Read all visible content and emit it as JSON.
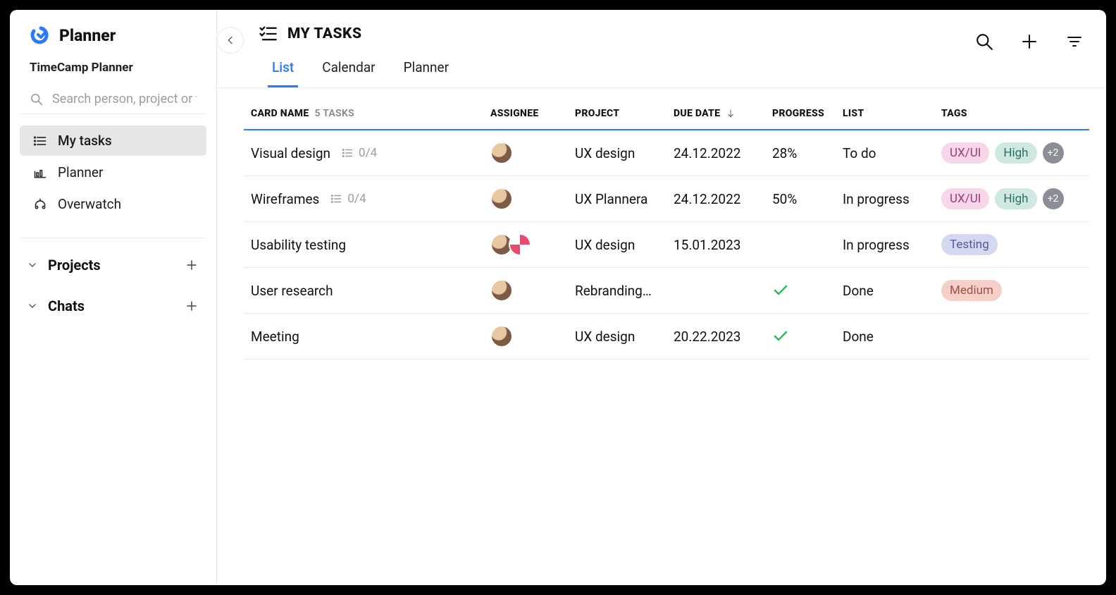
{
  "brand": {
    "app_name": "Planner",
    "org_name": "TimeCamp Planner"
  },
  "search": {
    "placeholder": "Search person, project or task"
  },
  "nav": {
    "items": [
      {
        "label": "My tasks",
        "icon": "tasks-icon",
        "active": true
      },
      {
        "label": "Planner",
        "icon": "planner-icon",
        "active": false
      },
      {
        "label": "Overwatch",
        "icon": "overwatch-icon",
        "active": false
      }
    ]
  },
  "sections": [
    {
      "title": "Projects"
    },
    {
      "title": "Chats"
    }
  ],
  "page": {
    "title": "MY TASKS",
    "tabs": [
      {
        "label": "List",
        "active": true
      },
      {
        "label": "Calendar",
        "active": false
      },
      {
        "label": "Planner",
        "active": false
      }
    ]
  },
  "table": {
    "headers": {
      "card_name": "CARD NAME",
      "task_count": "5 TASKS",
      "assignee": "ASSIGNEE",
      "project": "PROJECT",
      "due_date": "DUE DATE",
      "progress": "PROGRESS",
      "list": "LIST",
      "tags": "TAGS"
    },
    "rows": [
      {
        "name": "Visual design",
        "subtasks": "0/4",
        "assignees": 1,
        "project": "UX design",
        "due_date": "24.12.2022",
        "progress": "28%",
        "done": false,
        "list": "To do",
        "tags": [
          {
            "label": "UX/UI",
            "cls": "pink"
          },
          {
            "label": "High",
            "cls": "teal"
          }
        ],
        "tags_more": "+2"
      },
      {
        "name": "Wireframes",
        "subtasks": "0/4",
        "assignees": 1,
        "project": "UX Plannera",
        "due_date": "24.12.2022",
        "progress": "50%",
        "done": false,
        "list": "In progress",
        "tags": [
          {
            "label": "UX/UI",
            "cls": "pink"
          },
          {
            "label": "High",
            "cls": "teal"
          }
        ],
        "tags_more": "+2"
      },
      {
        "name": "Usability testing",
        "subtasks": "",
        "assignees": 2,
        "project": "UX design",
        "due_date": "15.01.2023",
        "progress": "",
        "done": false,
        "list": "In progress",
        "tags": [
          {
            "label": "Testing",
            "cls": "purple"
          }
        ],
        "tags_more": ""
      },
      {
        "name": "User research",
        "subtasks": "",
        "assignees": 1,
        "project": "Rebranding…",
        "due_date": "",
        "progress": "",
        "done": true,
        "list": "Done",
        "tags": [
          {
            "label": "Medium",
            "cls": "salmon"
          }
        ],
        "tags_more": ""
      },
      {
        "name": "Meeting",
        "subtasks": "",
        "assignees": 1,
        "project": "UX design",
        "due_date": "20.22.2023",
        "progress": "",
        "done": true,
        "list": "Done",
        "tags": [],
        "tags_more": ""
      }
    ]
  }
}
